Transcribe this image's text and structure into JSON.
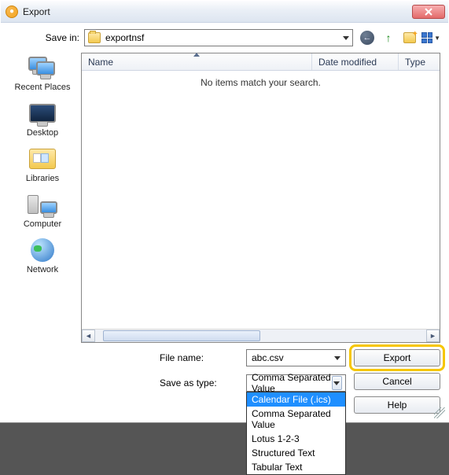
{
  "window": {
    "title": "Export"
  },
  "savein": {
    "label": "Save in:",
    "folder": "exportnsf"
  },
  "columns": {
    "name": "Name",
    "date": "Date modified",
    "type": "Type"
  },
  "empty_message": "No items match your search.",
  "places": {
    "recent": "Recent Places",
    "desktop": "Desktop",
    "libraries": "Libraries",
    "computer": "Computer",
    "network": "Network"
  },
  "form": {
    "filename_label": "File name:",
    "filename_value": "abc.csv",
    "savetype_label": "Save as type:",
    "savetype_value": "Comma Separated Value",
    "options": {
      "o0": "Calendar File (.ics)",
      "o1": "Comma Separated Value",
      "o2": "Lotus 1-2-3",
      "o3": "Structured Text",
      "o4": "Tabular Text"
    }
  },
  "buttons": {
    "export": "Export",
    "cancel": "Cancel",
    "help": "Help"
  }
}
